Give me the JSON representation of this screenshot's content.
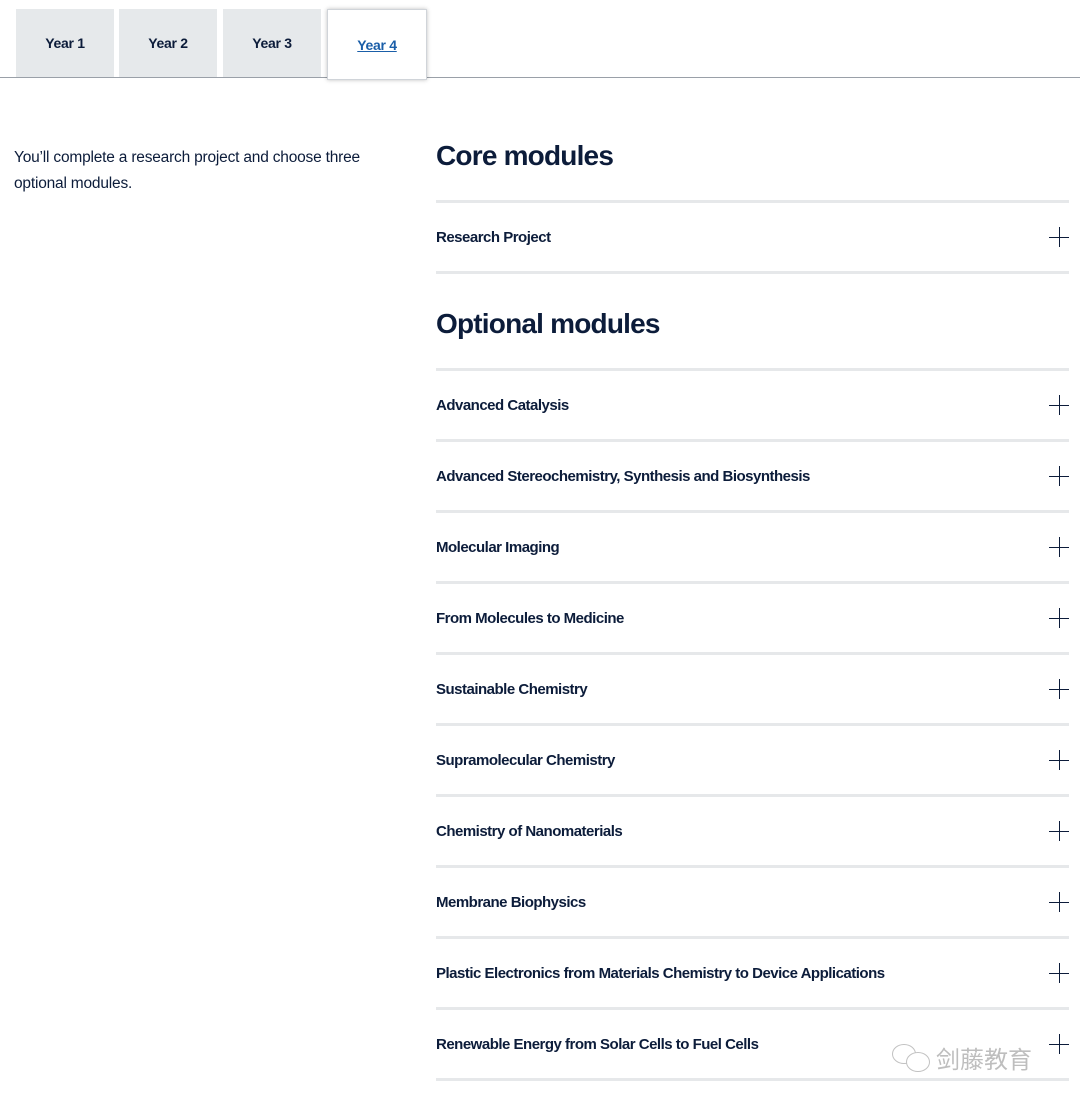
{
  "tabs": [
    {
      "label": "Year 1",
      "active": false
    },
    {
      "label": "Year 2",
      "active": false
    },
    {
      "label": "Year 3",
      "active": false
    },
    {
      "label": "Year 4",
      "active": true
    }
  ],
  "intro": "You’ll complete a research project and choose three optional modules.",
  "core": {
    "heading": "Core modules",
    "modules": [
      "Research Project"
    ]
  },
  "optional": {
    "heading": "Optional modules",
    "modules": [
      "Advanced Catalysis",
      "Advanced Stereochemistry, Synthesis and Biosynthesis",
      "Molecular Imaging",
      "From Molecules to Medicine",
      "Sustainable Chemistry",
      "Supramolecular Chemistry",
      "Chemistry of Nanomaterials",
      "Membrane Biophysics",
      "Plastic Electronics from Materials Chemistry to Device Applications",
      "Renewable Energy from Solar Cells to Fuel Cells"
    ]
  },
  "icons": {
    "expand": "plus-icon"
  },
  "watermark": "剑藤教育"
}
